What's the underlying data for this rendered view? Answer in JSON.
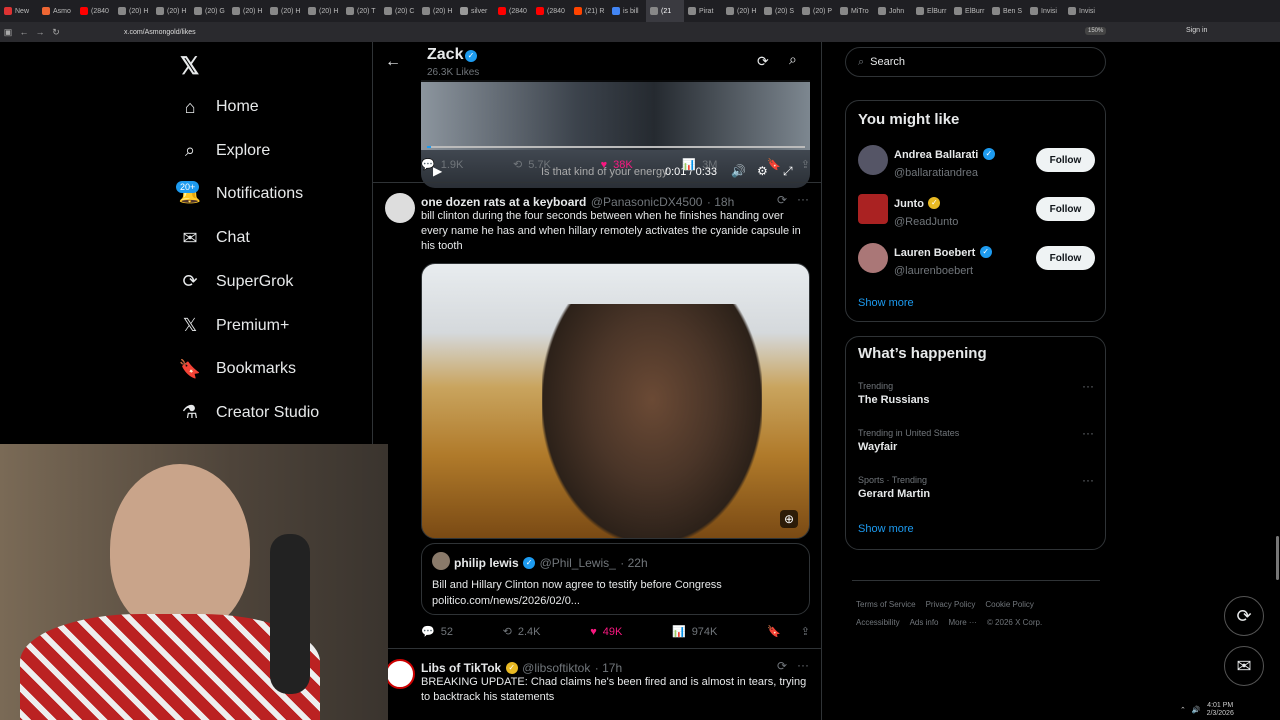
{
  "browser": {
    "tabs": [
      {
        "label": "New",
        "icon": "firefox",
        "color": "#d33"
      },
      {
        "label": "Asmo",
        "icon": "asmon",
        "color": "#e63"
      },
      {
        "label": "(2840",
        "icon": "youtube",
        "color": "#f00"
      },
      {
        "label": "(20) H",
        "icon": "x",
        "color": "#888"
      },
      {
        "label": "(20) H",
        "icon": "x",
        "color": "#888"
      },
      {
        "label": "(20) G",
        "icon": "x",
        "color": "#888"
      },
      {
        "label": "(20) H",
        "icon": "x",
        "color": "#888"
      },
      {
        "label": "(20) H",
        "icon": "x",
        "color": "#888"
      },
      {
        "label": "(20) H",
        "icon": "x",
        "color": "#888"
      },
      {
        "label": "(20) T",
        "icon": "x",
        "color": "#888"
      },
      {
        "label": "(20) C",
        "icon": "x",
        "color": "#888"
      },
      {
        "label": "(20) H",
        "icon": "x",
        "color": "#888"
      },
      {
        "label": "silver",
        "icon": "globe",
        "color": "#999"
      },
      {
        "label": "(2840",
        "icon": "youtube",
        "color": "#f00"
      },
      {
        "label": "(2840",
        "icon": "youtube",
        "color": "#f00"
      },
      {
        "label": "(21) R",
        "icon": "reddit",
        "color": "#f40"
      },
      {
        "label": "is bill",
        "icon": "google",
        "color": "#4285f4"
      },
      {
        "label": "(21",
        "icon": "x",
        "color": "#888"
      },
      {
        "label": "Pirat",
        "icon": "x",
        "color": "#888"
      },
      {
        "label": "(20) H",
        "icon": "x",
        "color": "#888"
      },
      {
        "label": "(20) S",
        "icon": "x",
        "color": "#888"
      },
      {
        "label": "(20) P",
        "icon": "x",
        "color": "#888"
      },
      {
        "label": "MiTro",
        "icon": "x",
        "color": "#888"
      },
      {
        "label": "John",
        "icon": "x",
        "color": "#888"
      },
      {
        "label": "ElBurr",
        "icon": "x",
        "color": "#888"
      },
      {
        "label": "ElBurr",
        "icon": "x",
        "color": "#888"
      },
      {
        "label": "Ben S",
        "icon": "x",
        "color": "#888"
      },
      {
        "label": "Invisi",
        "icon": "x",
        "color": "#888"
      },
      {
        "label": "Invisi",
        "icon": "x",
        "color": "#888"
      }
    ],
    "url": "x.com/Asmongold/likes",
    "zoom": "150%",
    "sign_in": "Sign in"
  },
  "sidebar": {
    "logo": "𝕏",
    "badge": "20+",
    "items": [
      {
        "label": "Home",
        "icon": "home-icon"
      },
      {
        "label": "Explore",
        "icon": "search-icon"
      },
      {
        "label": "Notifications",
        "icon": "bell-icon"
      },
      {
        "label": "Chat",
        "icon": "mail-icon"
      },
      {
        "label": "SuperGrok",
        "icon": "grok-icon"
      },
      {
        "label": "Premium+",
        "icon": "x-icon"
      },
      {
        "label": "Bookmarks",
        "icon": "bookmark-icon"
      },
      {
        "label": "Creator Studio",
        "icon": "flask-icon"
      }
    ]
  },
  "header": {
    "name": "Zack",
    "subtitle": "26.3K Likes"
  },
  "video": {
    "caption": "Is that kind of your energy",
    "time": "0:01 / 0:33"
  },
  "tweet1_actions": {
    "replies": "1.9K",
    "reposts": "5.7K",
    "likes": "38K",
    "views": "3M"
  },
  "tweet2": {
    "name": "one dozen rats at a keyboard",
    "handle": "@PanasonicDX4500",
    "time": "· 18h",
    "text": "bill clinton during the four seconds between when he finishes handing over every name he has and when hillary remotely activates the cyanide capsule in his tooth",
    "quote": {
      "name": "philip lewis",
      "handle": "@Phil_Lewis_",
      "time": "· 22h",
      "text": "Bill and Hillary Clinton now agree to testify before Congress",
      "link": "politico.com/news/2026/02/0..."
    },
    "actions": {
      "replies": "52",
      "reposts": "2.4K",
      "likes": "49K",
      "views": "974K"
    }
  },
  "tweet3": {
    "name": "Libs of TikTok",
    "handle": "@libsoftiktok",
    "time": "· 17h",
    "text": "BREAKING UPDATE: Chad claims he's been fired and is almost in tears, trying to backtrack his statements"
  },
  "search": {
    "placeholder": "Search"
  },
  "you_might_like": {
    "title": "You might like",
    "people": [
      {
        "name": "Andrea Ballarati",
        "handle": "@ballaratiandrea",
        "button": "Follow",
        "badge": "blue"
      },
      {
        "name": "Junto",
        "handle": "@ReadJunto",
        "button": "Follow",
        "badge": "gold"
      },
      {
        "name": "Lauren Boebert",
        "handle": "@laurenboebert",
        "button": "Follow",
        "badge": "blue"
      }
    ],
    "show_more": "Show more"
  },
  "whats_happening": {
    "title": "What’s happening",
    "trends": [
      {
        "meta": "Trending",
        "name": "The Russians"
      },
      {
        "meta": "Trending in United States",
        "name": "Wayfair"
      },
      {
        "meta": "Sports · Trending",
        "name": "Gerard Martin"
      }
    ],
    "show_more": "Show more"
  },
  "footer": {
    "links": [
      "Terms of Service",
      "Privacy Policy",
      "Cookie Policy",
      "Accessibility",
      "Ads info",
      "More ···",
      "© 2026 X Corp."
    ]
  },
  "taskbar": {
    "time": "4:01 PM",
    "date": "2/3/2026"
  },
  "colors": {
    "accent": "#1d9bf0",
    "like": "#f91880",
    "background": "#000000"
  }
}
